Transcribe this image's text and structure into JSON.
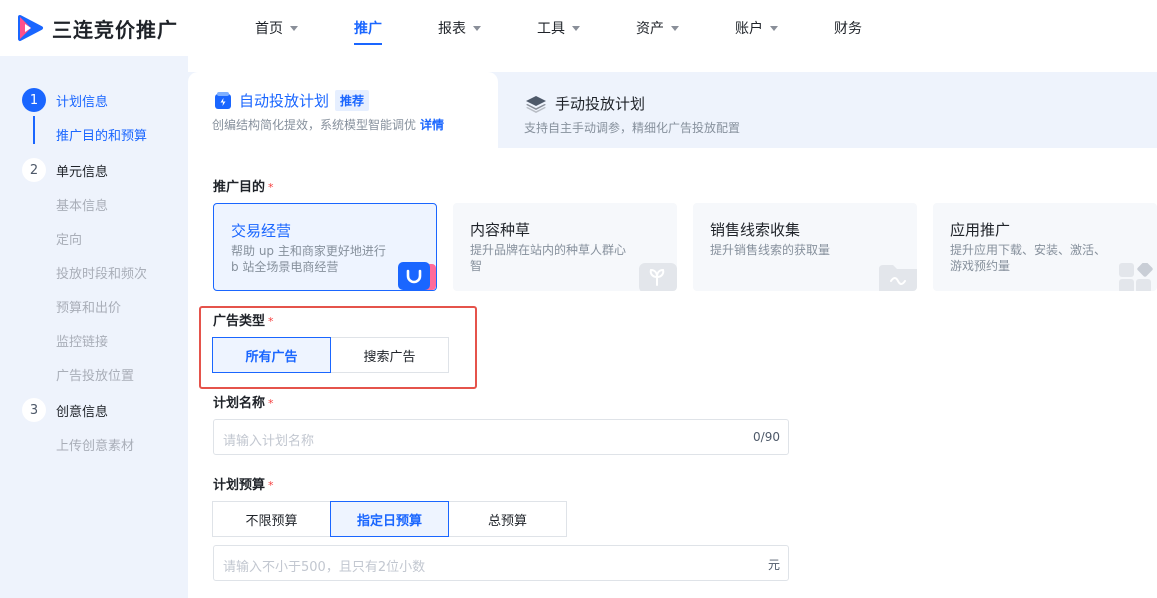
{
  "app": {
    "title": "三连竞价推广"
  },
  "nav": [
    {
      "label": "首页",
      "has_caret": true,
      "active": false
    },
    {
      "label": "推广",
      "has_caret": false,
      "active": true
    },
    {
      "label": "报表",
      "has_caret": true,
      "active": false
    },
    {
      "label": "工具",
      "has_caret": true,
      "active": false
    },
    {
      "label": "资产",
      "has_caret": true,
      "active": false
    },
    {
      "label": "账户",
      "has_caret": true,
      "active": false
    },
    {
      "label": "财务",
      "has_caret": false,
      "active": false
    }
  ],
  "sidebar": {
    "steps": [
      {
        "num": "1",
        "title": "计划信息",
        "sub": [
          "推广目的和预算"
        ]
      },
      {
        "num": "2",
        "title": "单元信息",
        "sub": [
          "基本信息",
          "定向",
          "投放时段和频次",
          "预算和出价",
          "监控链接",
          "广告投放位置"
        ]
      },
      {
        "num": "3",
        "title": "创意信息",
        "sub": [
          "上传创意素材"
        ]
      }
    ]
  },
  "tabs": {
    "auto": {
      "title": "自动投放计划",
      "badge": "推荐",
      "desc": "创编结构简化提效，系统模型智能调优",
      "link": "详情"
    },
    "manual": {
      "title": "手动投放计划",
      "desc": "支持自主手动调参，精细化广告投放配置"
    }
  },
  "form": {
    "purpose": {
      "label": "推广目的",
      "required": "*",
      "cards": [
        {
          "title": "交易经营",
          "desc": "帮助 up 主和商家更好地进行 b 站全场景电商经营",
          "selected": true
        },
        {
          "title": "内容种草",
          "desc": "提升品牌在站内的种草人群心智",
          "selected": false
        },
        {
          "title": "销售线索收集",
          "desc": "提升销售线索的获取量",
          "selected": false
        },
        {
          "title": "应用推广",
          "desc": "提升应用下载、安装、激活、游戏预约量",
          "selected": false
        }
      ]
    },
    "ad_type": {
      "label": "广告类型",
      "required": "*",
      "options": [
        "所有广告",
        "搜索广告"
      ],
      "selected": "所有广告"
    },
    "plan_name": {
      "label": "计划名称",
      "required": "*",
      "placeholder": "请输入计划名称",
      "counter": "0/90"
    },
    "budget": {
      "label": "计划预算",
      "required": "*",
      "options": [
        "不限预算",
        "指定日预算",
        "总预算"
      ],
      "selected": "指定日预算",
      "placeholder": "请输入不小于500，且只有2位小数",
      "unit": "元"
    }
  },
  "colors": {
    "accent": "#1a66ff",
    "sidebar_bg": "#eef3fc",
    "highlight": "#e5534b",
    "required": "#f53f3f"
  }
}
